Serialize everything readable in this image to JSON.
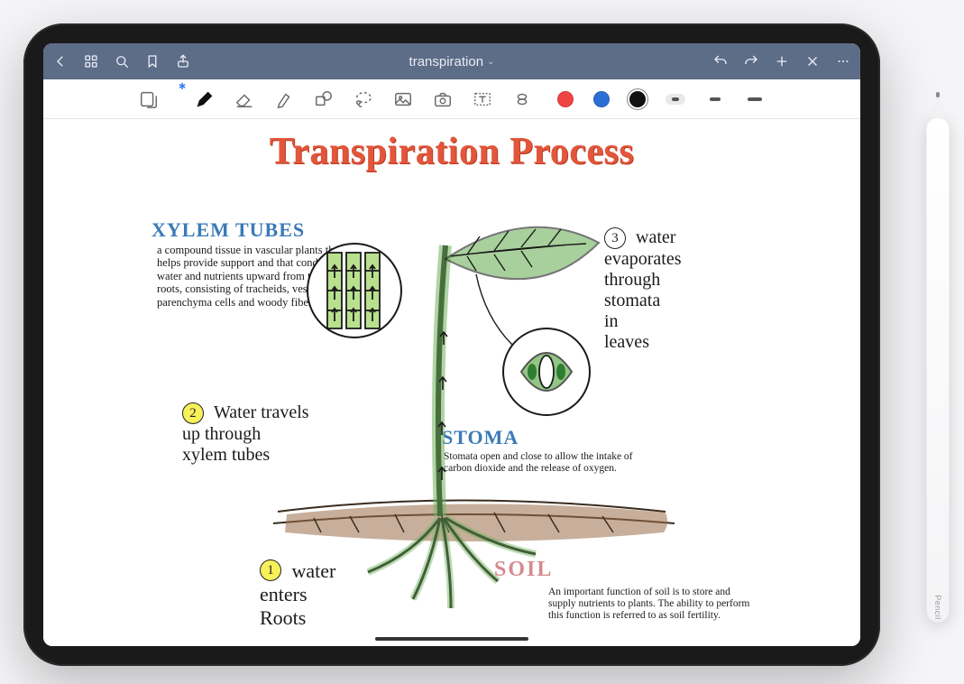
{
  "titlebar": {
    "back": "Back",
    "grid": "Thumbnails",
    "search": "Search",
    "bookmark": "Bookmark",
    "share": "Share",
    "title": "transpiration",
    "undo": "Undo",
    "redo": "Redo",
    "add": "Add Page",
    "close": "Close",
    "more": "More"
  },
  "toolbar": {
    "tools": {
      "view": "View Mode",
      "pen": "Pen",
      "eraser": "Eraser",
      "highlighter": "Highlighter",
      "shape": "Shape",
      "lasso": "Lasso",
      "image": "Image",
      "camera": "Camera",
      "text": "Text Box",
      "link": "Link"
    },
    "colors": {
      "red": "#ef4444",
      "blue": "#2b6fd6",
      "black": "#111111"
    },
    "strokes": {
      "thin": 8,
      "med": 12,
      "thick": 16
    },
    "selected_color": "black",
    "selected_stroke": "thin",
    "bluetooth": "✱"
  },
  "note": {
    "title": "Transpiration Process",
    "sections": {
      "xylem": {
        "heading": "XYLEM TUBES",
        "body": "a compound tissue in vascular plants that helps provide support and that conducts water and nutrients upward from the roots, consisting of tracheids, vessels, parenchyma cells and woody fibers."
      },
      "stoma": {
        "heading": "STOMA",
        "body": "Stomata open and close to allow the intake of carbon dioxide and the release of oxygen."
      },
      "soil": {
        "heading": "SOIL",
        "body": "An important function of soil is to store and supply nutrients to plants. The ability to perform this function is referred to as soil fertility."
      }
    },
    "steps": {
      "s1": {
        "num": "1",
        "text": "water\nenters\nRoots"
      },
      "s2": {
        "num": "2",
        "text": "Water travels\nup through\nxylem tubes"
      },
      "s3": {
        "num": "3",
        "text": "water\nevaporates\nthrough\nstomata\nin\nleaves"
      }
    }
  },
  "pencil": {
    "label": "Pencil"
  }
}
